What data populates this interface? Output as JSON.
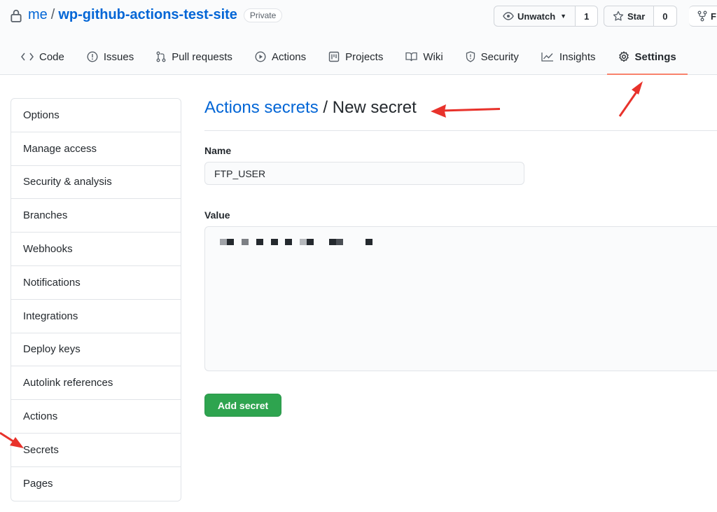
{
  "repo": {
    "owner": "me",
    "separator": "/",
    "name": "wp-github-actions-test-site",
    "visibility": "Private"
  },
  "actions": {
    "unwatch_label": "Unwatch",
    "unwatch_count": "1",
    "star_label": "Star",
    "star_count": "0",
    "fork_label": "F"
  },
  "tabs": [
    {
      "label": "Code",
      "icon": "code-icon"
    },
    {
      "label": "Issues",
      "icon": "issue-icon"
    },
    {
      "label": "Pull requests",
      "icon": "pull-request-icon"
    },
    {
      "label": "Actions",
      "icon": "play-icon"
    },
    {
      "label": "Projects",
      "icon": "project-icon"
    },
    {
      "label": "Wiki",
      "icon": "book-icon"
    },
    {
      "label": "Security",
      "icon": "shield-icon"
    },
    {
      "label": "Insights",
      "icon": "graph-icon"
    },
    {
      "label": "Settings",
      "icon": "gear-icon",
      "active": true
    }
  ],
  "sidebar": {
    "items": [
      {
        "label": "Options"
      },
      {
        "label": "Manage access"
      },
      {
        "label": "Security & analysis"
      },
      {
        "label": "Branches"
      },
      {
        "label": "Webhooks"
      },
      {
        "label": "Notifications"
      },
      {
        "label": "Integrations"
      },
      {
        "label": "Deploy keys"
      },
      {
        "label": "Autolink references"
      },
      {
        "label": "Actions"
      },
      {
        "label": "Secrets"
      },
      {
        "label": "Pages"
      }
    ]
  },
  "main": {
    "breadcrumb_link": "Actions secrets",
    "breadcrumb_sep": " / ",
    "breadcrumb_current": "New secret",
    "name_label": "Name",
    "name_value": "FTP_USER",
    "value_label": "Value",
    "value_redacted": true,
    "submit_label": "Add secret"
  },
  "colors": {
    "link": "#0366d6",
    "primary_button": "#2ea44f",
    "active_tab_underline": "#f9826c",
    "annotation_arrow": "#e8322b"
  }
}
